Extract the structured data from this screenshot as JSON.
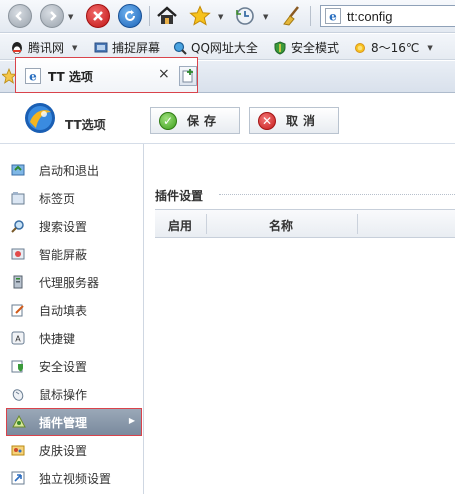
{
  "browser": {
    "address_url": "tt:config"
  },
  "favorites": [
    {
      "label": "腾讯网",
      "icon": "qq-icon"
    },
    {
      "label": "捕捉屏幕",
      "icon": "screenshot-icon"
    },
    {
      "label": "QQ网址大全",
      "icon": "qq-search-icon"
    },
    {
      "label": "安全模式",
      "icon": "shield-icon"
    },
    {
      "label": "8～16℃",
      "icon": "weather-sun-icon"
    }
  ],
  "tab": {
    "title": "TT 选项",
    "close": "×"
  },
  "header": {
    "app_title": "TT选项",
    "save_label": "保存",
    "cancel_label": "取消"
  },
  "sidebar": {
    "items": [
      {
        "label": "启动和退出",
        "icon": "startup-exit-icon"
      },
      {
        "label": "标签页",
        "icon": "tabs-icon"
      },
      {
        "label": "搜索设置",
        "icon": "search-icon"
      },
      {
        "label": "智能屏蔽",
        "icon": "block-icon"
      },
      {
        "label": "代理服务器",
        "icon": "proxy-server-icon"
      },
      {
        "label": "自动填表",
        "icon": "autofill-icon"
      },
      {
        "label": "快捷键",
        "icon": "hotkey-icon"
      },
      {
        "label": "安全设置",
        "icon": "security-icon"
      },
      {
        "label": "鼠标操作",
        "icon": "mouse-icon"
      },
      {
        "label": "插件管理",
        "icon": "plugin-icon",
        "active": true
      },
      {
        "label": "皮肤设置",
        "icon": "skin-icon"
      },
      {
        "label": "独立视频设置",
        "icon": "video-icon"
      }
    ]
  },
  "content": {
    "section_title": "插件设置",
    "columns": [
      "启用",
      "名称"
    ]
  },
  "colors": {
    "highlight_border": "#d9434b",
    "active_item_bg": "#8a98aa",
    "save_green": "#3c9e1a",
    "cancel_red": "#c41b1b"
  }
}
